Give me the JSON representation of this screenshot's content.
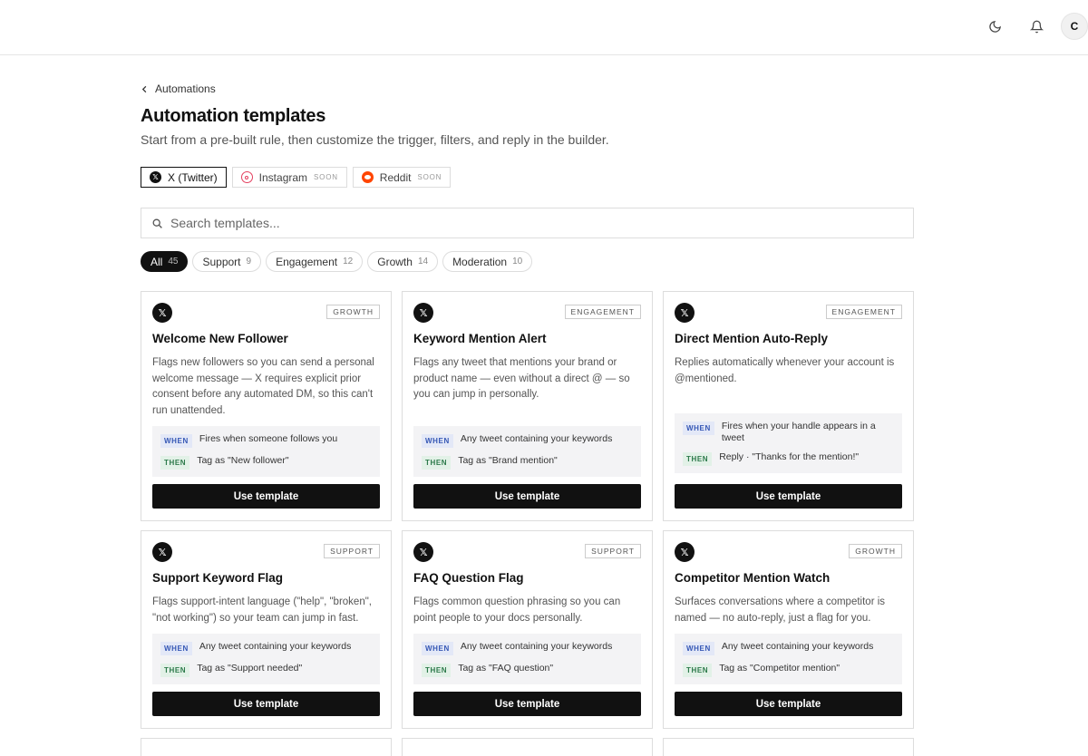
{
  "topbar": {
    "avatar_initial": "C",
    "icons": [
      "moon-icon",
      "bell-icon"
    ]
  },
  "breadcrumb": {
    "label": "Automations"
  },
  "page": {
    "title": "Automation templates",
    "subtitle": "Start from a pre-built rule, then customize the trigger, filters, and reply in the builder."
  },
  "platforms": [
    {
      "label": "X (Twitter)",
      "badge": "",
      "icon": "x-logo-icon",
      "active": true
    },
    {
      "label": "Instagram",
      "badge": "SOON",
      "icon": "instagram-logo-icon",
      "active": false
    },
    {
      "label": "Reddit",
      "badge": "SOON",
      "icon": "reddit-logo-icon",
      "active": false
    }
  ],
  "search": {
    "placeholder": "Search templates..."
  },
  "filters": [
    {
      "label": "All",
      "count": "45",
      "active": true
    },
    {
      "label": "Support",
      "count": "9"
    },
    {
      "label": "Engagement",
      "count": "12"
    },
    {
      "label": "Growth",
      "count": "14"
    },
    {
      "label": "Moderation",
      "count": "10"
    }
  ],
  "cards": [
    {
      "category": "GROWTH",
      "title": "Welcome New Follower",
      "description": "Flags new followers so you can send a personal welcome message — X requires explicit prior consent before any automated DM, so this can't run unattended.",
      "when_label": "WHEN",
      "when": "Fires when someone follows you",
      "then_label": "THEN",
      "then": "Tag as \"New follower\"",
      "button": "Use template"
    },
    {
      "category": "ENGAGEMENT",
      "title": "Keyword Mention Alert",
      "description": "Flags any tweet that mentions your brand or product name — even without a direct @ — so you can jump in personally.",
      "when_label": "WHEN",
      "when": "Any tweet containing your keywords",
      "then_label": "THEN",
      "then": "Tag as \"Brand mention\"",
      "button": "Use template"
    },
    {
      "category": "ENGAGEMENT",
      "title": "Direct Mention Auto-Reply",
      "description": "Replies automatically whenever your account is @mentioned.",
      "when_label": "WHEN",
      "when": "Fires when your handle appears in a tweet",
      "then_label": "THEN",
      "then": "Reply · \"Thanks for the mention!\"",
      "button": "Use template"
    },
    {
      "category": "SUPPORT",
      "title": "Support Keyword Flag",
      "description": "Flags support-intent language (\"help\", \"broken\", \"not working\") so your team can jump in fast.",
      "when_label": "WHEN",
      "when": "Any tweet containing your keywords",
      "then_label": "THEN",
      "then": "Tag as \"Support needed\"",
      "button": "Use template"
    },
    {
      "category": "SUPPORT",
      "title": "FAQ Question Flag",
      "description": "Flags common question phrasing so you can point people to your docs personally.",
      "when_label": "WHEN",
      "when": "Any tweet containing your keywords",
      "then_label": "THEN",
      "then": "Tag as \"FAQ question\"",
      "button": "Use template"
    },
    {
      "category": "GROWTH",
      "title": "Competitor Mention Watch",
      "description": "Surfaces conversations where a competitor is named — no auto-reply, just a flag for you.",
      "when_label": "WHEN",
      "when": "Any tweet containing your keywords",
      "then_label": "THEN",
      "then": "Tag as \"Competitor mention\"",
      "button": "Use template"
    }
  ]
}
